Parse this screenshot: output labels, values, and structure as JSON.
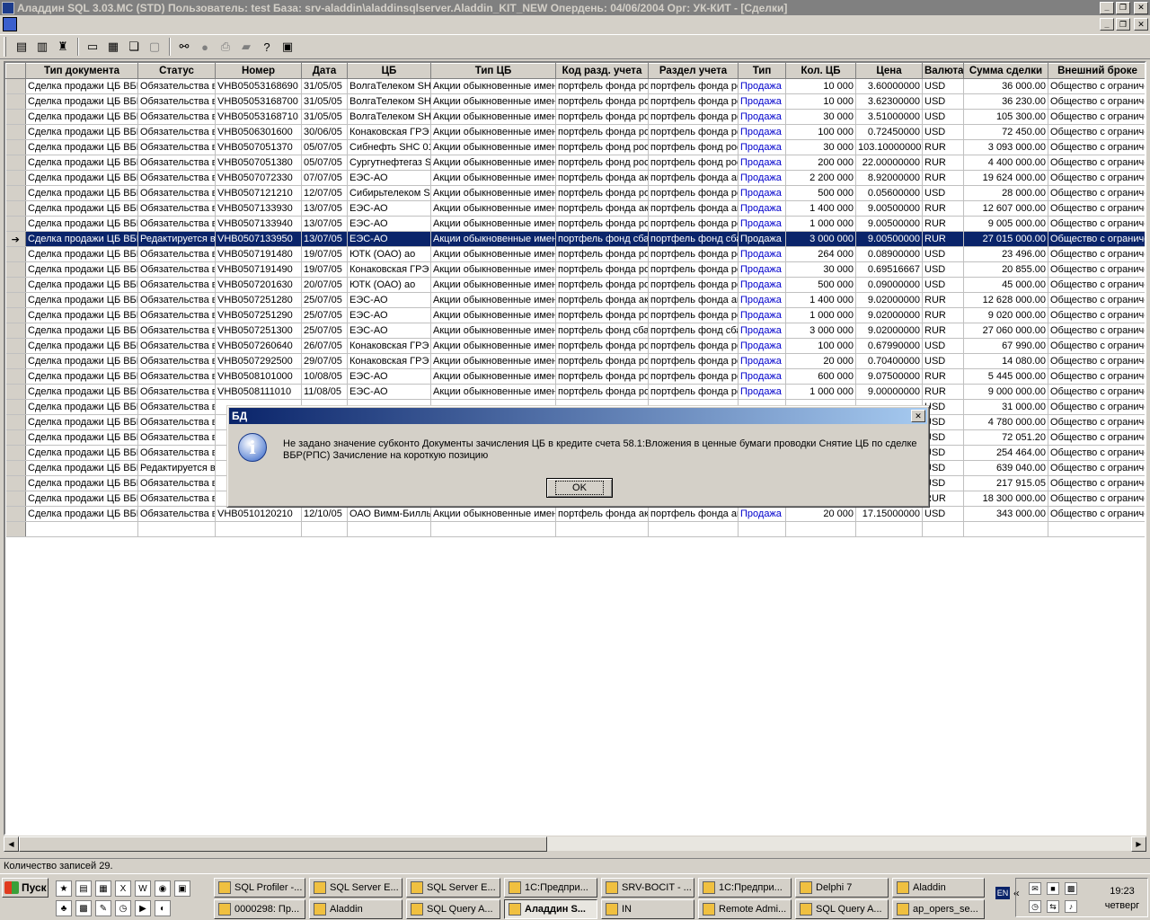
{
  "window": {
    "title": "Аладдин SQL 3.03.MC (STD)  Пользователь: test База: srv-aladdin\\aladdinsqlserver.Aladdin_KIT_NEW Опердень: 04/06/2004 Орг: УК-КИТ - [Сделки]"
  },
  "grid": {
    "columns": [
      "Тип документа",
      "Статус",
      "Номер",
      "Дата",
      "ЦБ",
      "Тип ЦБ",
      "Код разд. учета",
      "Раздел учета",
      "Тип",
      "Кол. ЦБ",
      "Цена",
      "Валюта",
      "Сумма сделки",
      "Внешний броке"
    ],
    "rows": [
      [
        "Сделка продажи ЦБ ВБР",
        "Обязательства в",
        "VHB05053168690",
        "31/05/05",
        "ВолгаТелеком SH",
        "Акции обыкновенные имен",
        "портфель фонда ро",
        "портфель фонда рс",
        "Продажа",
        "10 000",
        "3.60000000",
        "USD",
        "36 000.00",
        "Общество с ограниче"
      ],
      [
        "Сделка продажи ЦБ ВБР",
        "Обязательства в",
        "VHB05053168700",
        "31/05/05",
        "ВолгаТелеком SH",
        "Акции обыкновенные имен",
        "портфель фонда ро",
        "портфель фонда рс",
        "Продажа",
        "10 000",
        "3.62300000",
        "USD",
        "36 230.00",
        "Общество с ограниче"
      ],
      [
        "Сделка продажи ЦБ ВБР",
        "Обязательства в",
        "VHB05053168710",
        "31/05/05",
        "ВолгаТелеком SH",
        "Акции обыкновенные имен",
        "портфель фонда ро",
        "портфель фонда рс",
        "Продажа",
        "30 000",
        "3.51000000",
        "USD",
        "105 300.00",
        "Общество с ограниче"
      ],
      [
        "Сделка продажи ЦБ ВБР",
        "Обязательства в",
        "VHB0506301600",
        "30/06/05",
        "Конаковская ГРЭ",
        "Акции обыкновенные имен",
        "портфель фонда ро",
        "портфель фонда рс",
        "Продажа",
        "100 000",
        "0.72450000",
        "USD",
        "72 450.00",
        "Общество с ограниче"
      ],
      [
        "Сделка продажи ЦБ ВБР",
        "Обязательства в",
        "VHB0507051370",
        "05/07/05",
        "Сибнефть SHC  01",
        "Акции обыкновенные имен",
        "портфель фонд рос",
        "портфель фонд рос",
        "Продажа",
        "30 000",
        "103.10000000",
        "RUR",
        "3 093 000.00",
        "Общество с ограниче"
      ],
      [
        "Сделка продажи ЦБ ВБР",
        "Обязательства в",
        "VHB0507051380",
        "05/07/05",
        "Сургутнефтегаз S",
        "Акции обыкновенные имен",
        "портфель фонд рос",
        "портфель фонд рос",
        "Продажа",
        "200 000",
        "22.00000000",
        "RUR",
        "4 400 000.00",
        "Общество с ограниче"
      ],
      [
        "Сделка продажи ЦБ ВБР",
        "Обязательства в",
        "VHB0507072330",
        "07/07/05",
        "ЕЭС-АО",
        "Акции обыкновенные имен",
        "портфель фонда ак",
        "портфель фонда ак",
        "Продажа",
        "2 200 000",
        "8.92000000",
        "RUR",
        "19 624 000.00",
        "Общество с ограниче"
      ],
      [
        "Сделка продажи ЦБ ВБР",
        "Обязательства в",
        "VHB0507121210",
        "12/07/05",
        "Сибирьтелеком S",
        "Акции обыкновенные имен",
        "портфель фонда ро",
        "портфель фонда рс",
        "Продажа",
        "500 000",
        "0.05600000",
        "USD",
        "28 000.00",
        "Общество с ограниче"
      ],
      [
        "Сделка продажи ЦБ ВБР",
        "Обязательства в",
        "VHB0507133930",
        "13/07/05",
        "ЕЭС-АО",
        "Акции обыкновенные имен",
        "портфель фонда ак",
        "портфель фонда ак",
        "Продажа",
        "1 400 000",
        "9.00500000",
        "RUR",
        "12 607 000.00",
        "Общество с ограниче"
      ],
      [
        "Сделка продажи ЦБ ВБР",
        "Обязательства в",
        "VHB0507133940",
        "13/07/05",
        "ЕЭС-АО",
        "Акции обыкновенные имен",
        "портфель фонда ро",
        "портфель фонда рс",
        "Продажа",
        "1 000 000",
        "9.00500000",
        "RUR",
        "9 005 000.00",
        "Общество с ограниче"
      ],
      [
        "Сделка продажи ЦБ ВБР",
        "Редактируется в",
        "VHB0507133950",
        "13/07/05",
        "ЕЭС-АО",
        "Акции обыкновенные имен",
        "портфель фонд сба",
        "портфель фонд сба",
        "Продажа",
        "3 000 000",
        "9.00500000",
        "RUR",
        "27 015 000.00",
        "Общество с ограниче"
      ],
      [
        "Сделка продажи ЦБ ВБР",
        "Обязательства в",
        "VHB0507191480",
        "19/07/05",
        "ЮТК (ОАО) ао",
        "Акции обыкновенные имен",
        "портфель фонда ро",
        "портфель фонда рс",
        "Продажа",
        "264 000",
        "0.08900000",
        "USD",
        "23 496.00",
        "Общество с ограниче"
      ],
      [
        "Сделка продажи ЦБ ВБР",
        "Обязательства в",
        "VHB0507191490",
        "19/07/05",
        "Конаковская ГРЭ",
        "Акции обыкновенные имен",
        "портфель фонда ро",
        "портфель фонда рс",
        "Продажа",
        "30 000",
        "0.69516667",
        "USD",
        "20 855.00",
        "Общество с ограниче"
      ],
      [
        "Сделка продажи ЦБ ВБР",
        "Обязательства в",
        "VHB0507201630",
        "20/07/05",
        "ЮТК (ОАО) ао",
        "Акции обыкновенные имен",
        "портфель фонда ро",
        "портфель фонда рс",
        "Продажа",
        "500 000",
        "0.09000000",
        "USD",
        "45 000.00",
        "Общество с ограниче"
      ],
      [
        "Сделка продажи ЦБ ВБР",
        "Обязательства в",
        "VHB0507251280",
        "25/07/05",
        "ЕЭС-АО",
        "Акции обыкновенные имен",
        "портфель фонда ак",
        "портфель фонда ак",
        "Продажа",
        "1 400 000",
        "9.02000000",
        "RUR",
        "12 628 000.00",
        "Общество с ограниче"
      ],
      [
        "Сделка продажи ЦБ ВБР",
        "Обязательства в",
        "VHB0507251290",
        "25/07/05",
        "ЕЭС-АО",
        "Акции обыкновенные имен",
        "портфель фонда ро",
        "портфель фонда рс",
        "Продажа",
        "1 000 000",
        "9.02000000",
        "RUR",
        "9 020 000.00",
        "Общество с ограниче"
      ],
      [
        "Сделка продажи ЦБ ВБР",
        "Обязательства в",
        "VHB0507251300",
        "25/07/05",
        "ЕЭС-АО",
        "Акции обыкновенные имен",
        "портфель фонд сба",
        "портфель фонд сба",
        "Продажа",
        "3 000 000",
        "9.02000000",
        "RUR",
        "27 060 000.00",
        "Общество с ограниче"
      ],
      [
        "Сделка продажи ЦБ ВБР",
        "Обязательства в",
        "VHB0507260640",
        "26/07/05",
        "Конаковская ГРЭ",
        "Акции обыкновенные имен",
        "портфель фонда ро",
        "портфель фонда рс",
        "Продажа",
        "100 000",
        "0.67990000",
        "USD",
        "67 990.00",
        "Общество с ограниче"
      ],
      [
        "Сделка продажи ЦБ ВБР",
        "Обязательства в",
        "VHB0507292500",
        "29/07/05",
        "Конаковская ГРЭ",
        "Акции обыкновенные имен",
        "портфель фонда ро",
        "портфель фонда рс",
        "Продажа",
        "20 000",
        "0.70400000",
        "USD",
        "14 080.00",
        "Общество с ограниче"
      ],
      [
        "Сделка продажи ЦБ ВБР",
        "Обязательства в",
        "VHB0508101000",
        "10/08/05",
        "ЕЭС-АО",
        "Акции обыкновенные имен",
        "портфель фонда ро",
        "портфель фонда рс",
        "Продажа",
        "600 000",
        "9.07500000",
        "RUR",
        "5 445 000.00",
        "Общество с ограниче"
      ],
      [
        "Сделка продажи ЦБ ВБР",
        "Обязательства в",
        "VHB0508111010",
        "11/08/05",
        "ЕЭС-АО",
        "Акции обыкновенные имен",
        "портфель фонда ро",
        "портфель фонда рс",
        "Продажа",
        "1 000 000",
        "9.00000000",
        "RUR",
        "9 000 000.00",
        "Общество с ограниче"
      ],
      [
        "Сделка продажи ЦБ ВБР",
        "Обязательства в",
        "",
        "",
        "",
        "",
        "",
        "",
        "",
        "",
        "",
        "USD",
        "31 000.00",
        "Общество с ограниче"
      ],
      [
        "Сделка продажи ЦБ ВБР",
        "Обязательства в",
        "",
        "",
        "",
        "",
        "",
        "",
        "",
        "",
        "",
        "USD",
        "4 780 000.00",
        "Общество с ограниче"
      ],
      [
        "Сделка продажи ЦБ ВБР",
        "Обязательства в",
        "",
        "",
        "",
        "",
        "",
        "",
        "",
        "",
        "",
        "USD",
        "72 051.20",
        "Общество с ограниче"
      ],
      [
        "Сделка продажи ЦБ ВБР",
        "Обязательства в",
        "",
        "",
        "",
        "",
        "",
        "",
        "",
        "",
        "",
        "USD",
        "254 464.00",
        "Общество с ограниче"
      ],
      [
        "Сделка продажи ЦБ ВБР",
        "Редактируется в",
        "",
        "",
        "",
        "",
        "",
        "",
        "",
        "",
        "",
        "USD",
        "639 040.00",
        "Общество с ограниче"
      ],
      [
        "Сделка продажи ЦБ ВБР",
        "Обязательства в",
        "",
        "",
        "",
        "",
        "",
        "",
        "",
        "",
        "",
        "USD",
        "217 915.05",
        "Общество с ограниче"
      ],
      [
        "Сделка продажи ЦБ ВБР",
        "Обязательства в",
        "",
        "",
        "",
        "",
        "",
        "",
        "",
        "",
        "",
        "RUR",
        "18 300 000.00",
        "Общество с ограниче"
      ],
      [
        "Сделка продажи ЦБ ВБР",
        "Обязательства в",
        "VHB0510120210",
        "12/10/05",
        "ОАО Вимм-Билль",
        "Акции обыкновенные имен",
        "портфель фонда ак",
        "портфель фонда ак",
        "Продажа",
        "20 000",
        "17.15000000",
        "USD",
        "343 000.00",
        "Общество с ограниче"
      ]
    ]
  },
  "statusbar": {
    "text": "Количество записей 29."
  },
  "dialog": {
    "title": "БД",
    "message": "Не задано значение субконто Документы зачисления ЦБ в кредите счета 58.1:Вложения в ценные бумаги проводки Снятие ЦБ по сделке ВБР(РПС) Зачисление на короткую позицию",
    "ok_label": "OK"
  },
  "taskbar": {
    "start_label": "Пуск",
    "tasks_row1": [
      "SQL Profiler -...",
      "SQL Server E...",
      "SQL Server E...",
      "1С:Предпри...",
      "SRV-BOCIT - ...",
      "1С:Предпри...",
      "Delphi 7",
      "Aladdin"
    ],
    "tasks_row2": [
      "0000298: Пр...",
      "Aladdin",
      "SQL Query A...",
      "Аладдин S...",
      "IN",
      "Remote Admi...",
      "SQL Query A...",
      "ap_opers_se..."
    ],
    "lang": "EN",
    "clock_time": "19:23",
    "clock_day": "четверг"
  }
}
